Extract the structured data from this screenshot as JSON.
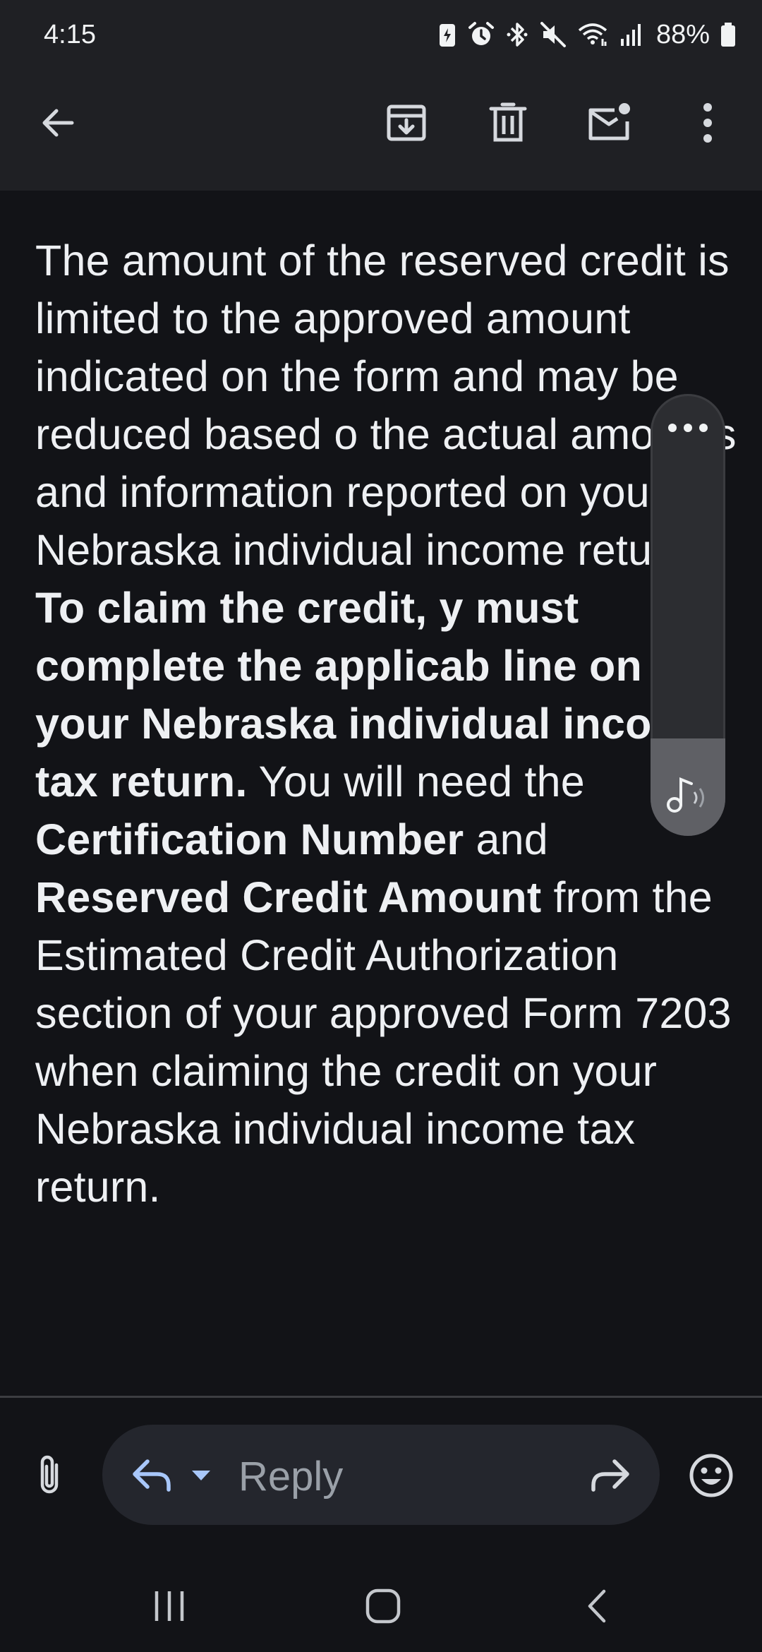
{
  "status_bar": {
    "time": "4:15",
    "battery_percent": "88%",
    "icons": [
      "battery-saver-icon",
      "alarm-icon",
      "bluetooth-icon",
      "mute-icon",
      "wifi-icon",
      "signal-icon",
      "battery-icon"
    ]
  },
  "app_bar": {
    "icons": [
      "back-arrow-icon",
      "archive-icon",
      "delete-icon",
      "mark-unread-icon",
      "more-vert-icon"
    ]
  },
  "email": {
    "p1": "The amount of the reserved credit is limited to the approved amount indicated on the form and may be reduced based o",
    "p2": "the actual amounts and information reported on you",
    "p3": "Nebraska individual income",
    "p4": "return.",
    "bold1": "To claim the credit, y",
    "bold2": "must complete the applicab",
    "bold3": "line on your Nebraska individual income tax return.",
    "t1": "You will need the",
    "bold4": "Certification Number",
    "t2": "and",
    "bold5": "Reserved Credit Amount",
    "t3": "from the Estimated Credit Authorization section of your approved Form 7203 when claiming the credit on your Nebraska individual income tax return."
  },
  "volume_panel": {
    "level": 0.22,
    "icons": [
      "more-horiz-icon",
      "music-note-icon"
    ]
  },
  "reply_bar": {
    "placeholder": "Reply",
    "icons": [
      "attach-icon",
      "reply-icon",
      "dropdown-icon",
      "forward-icon",
      "emoji-icon"
    ]
  },
  "nav_bar": {
    "icons": [
      "recents-icon",
      "home-icon",
      "nav-back-icon"
    ]
  },
  "colors": {
    "background": "#121317",
    "bar": "#1f2024",
    "accent": "#a8c7fa"
  }
}
